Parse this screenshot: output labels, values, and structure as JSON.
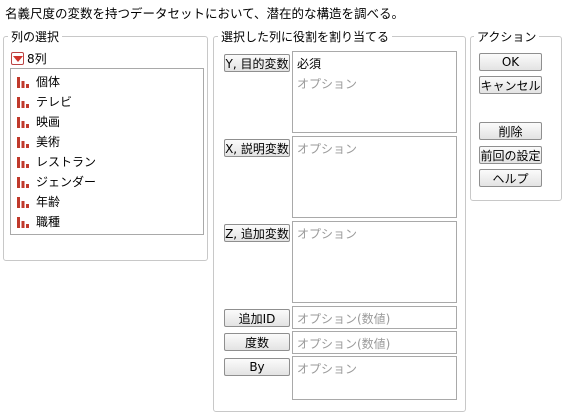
{
  "description": "名義尺度の変数を持つデータセットにおいて、潜在的な構造を調べる。",
  "column_select": {
    "title": "列の選択",
    "count_label": "8列",
    "columns": [
      "個体",
      "テレビ",
      "映画",
      "美術",
      "レストラン",
      "ジェンダー",
      "年齢",
      "職種"
    ]
  },
  "roles": {
    "title": "選択した列に役割を割り当てる",
    "y": {
      "label": "Y, 目的変数",
      "required": "必須",
      "placeholder": "オプション"
    },
    "x": {
      "label": "X, 説明変数",
      "placeholder": "オプション"
    },
    "z": {
      "label": "Z, 追加変数",
      "placeholder": "オプション"
    },
    "id": {
      "label": "追加ID",
      "placeholder": "オプション(数値)"
    },
    "freq": {
      "label": "度数",
      "placeholder": "オプション(数値)"
    },
    "by": {
      "label": "By",
      "placeholder": "オプション"
    }
  },
  "actions": {
    "title": "アクション",
    "ok": "OK",
    "cancel": "キャンセル",
    "delete": "削除",
    "recall": "前回の設定",
    "help": "ヘルプ"
  },
  "colors": {
    "nominal_icon": "#c0392b",
    "group_border": "#c8c8c8"
  }
}
